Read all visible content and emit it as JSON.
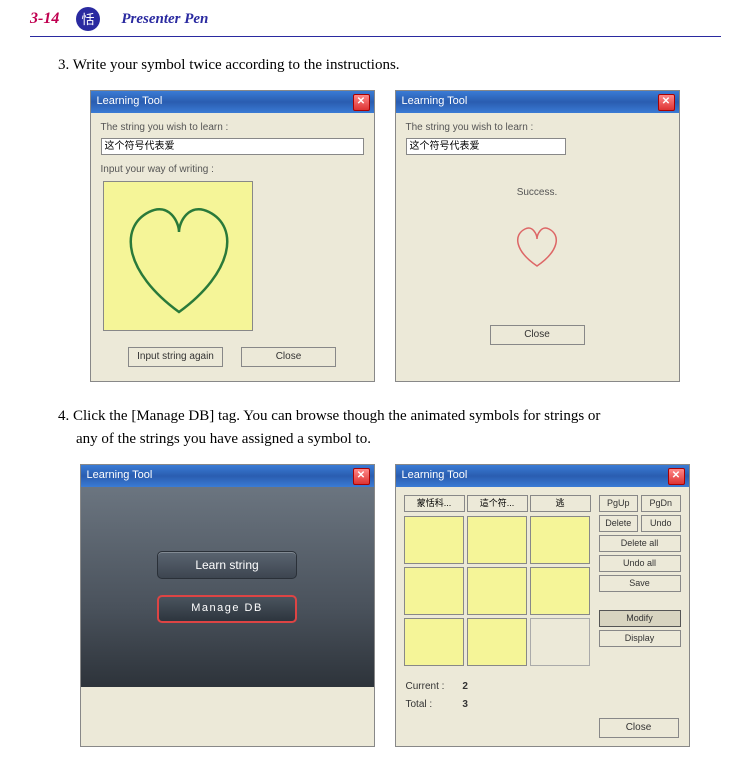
{
  "header": {
    "page_number": "3-14",
    "section_title": "Presenter Pen"
  },
  "steps": {
    "s3": "3. Write your symbol twice according to the instructions.",
    "s4a": "4. Click the [Manage DB] tag. You can browse though the animated symbols for strings or",
    "s4b": "any of the strings you have assigned a symbol to."
  },
  "dialogs": {
    "d1": {
      "title": "Learning Tool",
      "label_learn": "The string you wish to learn :",
      "string_value": "这个符号代表爱",
      "label_input": "Input your way of writing :",
      "btn_again": "Input string again",
      "btn_close": "Close"
    },
    "d2": {
      "title": "Learning Tool",
      "label_learn": "The string you wish to learn :",
      "string_value": "这个符号代表爱",
      "success": "Success.",
      "btn_close": "Close"
    },
    "d3": {
      "title": "Learning Tool",
      "btn_learn": "Learn string",
      "btn_manage": "Manage DB"
    },
    "d4": {
      "title": "Learning Tool",
      "tabs": [
        "蒙恬科...",
        "這个符...",
        "逃"
      ],
      "side": {
        "pgup": "PgUp",
        "pgdn": "PgDn",
        "delete": "Delete",
        "undo": "Undo",
        "delete_all": "Delete all",
        "undo_all": "Undo all",
        "save": "Save",
        "modify": "Modify",
        "display": "Display"
      },
      "stats": {
        "current_label": "Current :",
        "current_value": "2",
        "total_label": "Total :",
        "total_value": "3"
      },
      "btn_close": "Close"
    }
  }
}
